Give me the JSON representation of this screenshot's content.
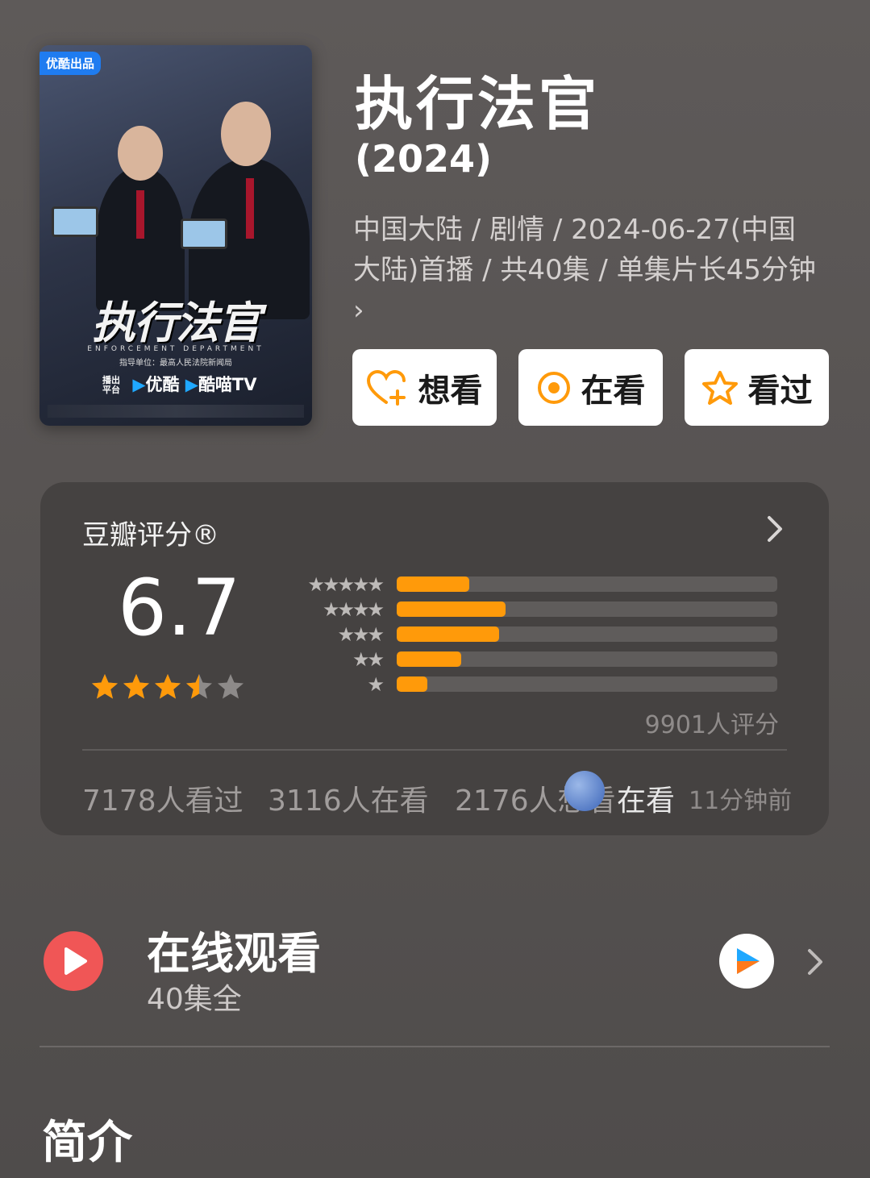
{
  "poster": {
    "badge": "优酷出品",
    "title_art": "执行法官",
    "subtitle_en": "ENFORCEMENT DEPARTMENT",
    "guidance": "指导单位：最高人民法院新闻局",
    "platform_label": "播出平台",
    "platform_1": "优酷",
    "platform_2": "酷喵TV"
  },
  "header": {
    "title": "执行法官",
    "year": "(2024)",
    "meta": "中国大陆 / 剧情 / 2024-06-27(中国大陆)首播 / 共40集 / 单集片长45分钟 ›"
  },
  "actions": [
    {
      "label": "想看",
      "icon": "heart-plus-icon"
    },
    {
      "label": "在看",
      "icon": "target-icon"
    },
    {
      "label": "看过",
      "icon": "star-outline-icon"
    }
  ],
  "rating": {
    "title": "豆瓣评分®",
    "score": "6.7",
    "stars_value": 3.5,
    "breakdown": [
      {
        "stars": "★★★★★",
        "fraction": 0.19
      },
      {
        "stars": "★★★★",
        "fraction": 0.285
      },
      {
        "stars": "★★★",
        "fraction": 0.27
      },
      {
        "stars": "★★",
        "fraction": 0.17
      },
      {
        "stars": "★",
        "fraction": 0.08
      }
    ],
    "count": "9901人评分",
    "stats": [
      "7178人看过",
      "3116人在看",
      "2176人想看"
    ]
  },
  "toast": {
    "text": "在看",
    "time": "11分钟前"
  },
  "online": {
    "title": "在线观看",
    "subtitle": "40集全"
  },
  "intro": {
    "title": "简介"
  },
  "colors": {
    "accent_orange": "#ff9a0a",
    "play_red": "#f05656",
    "youku_blue": "#1fa8ff"
  }
}
